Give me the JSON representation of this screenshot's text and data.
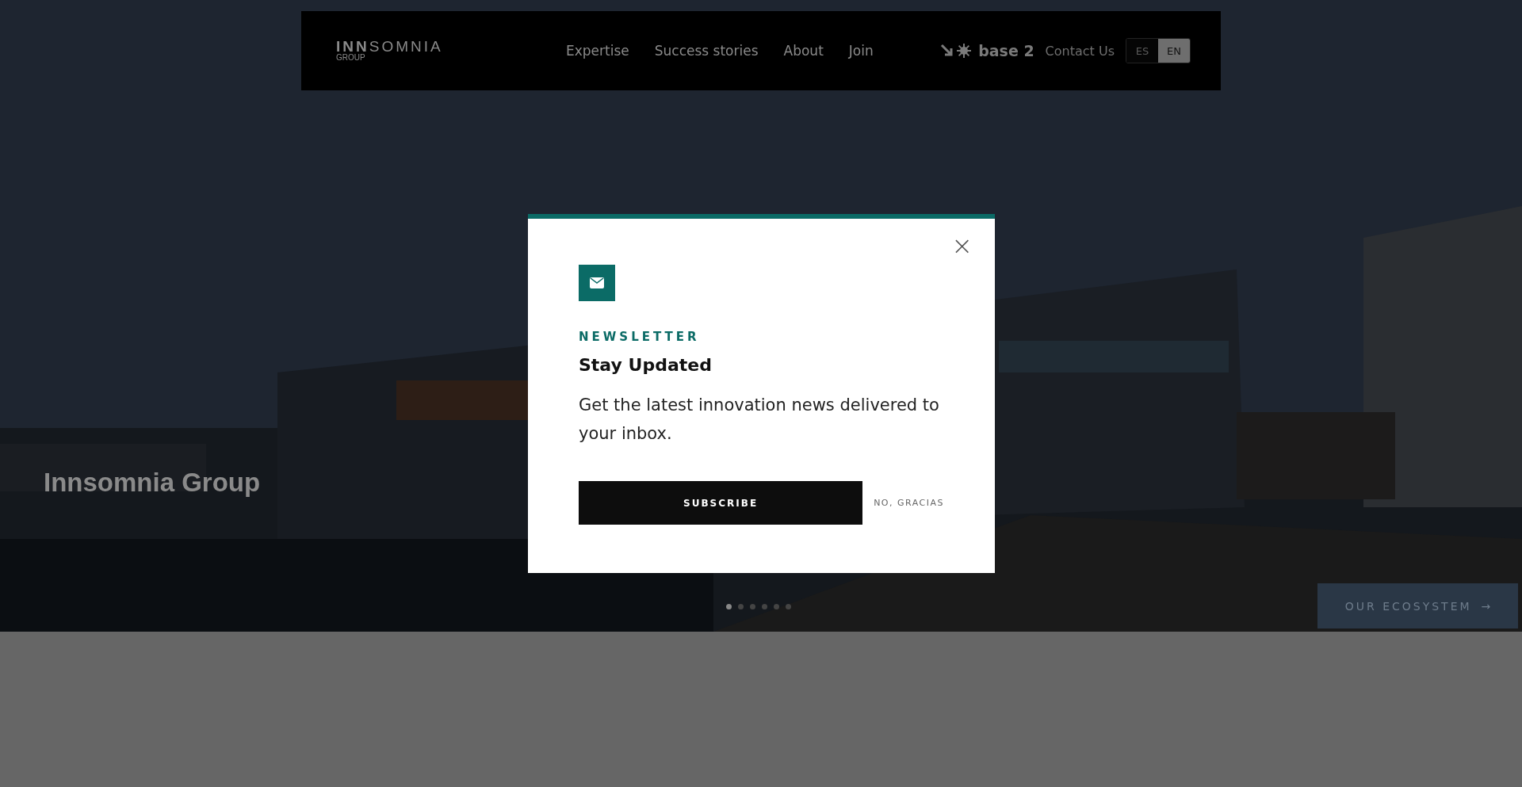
{
  "header": {
    "logo": {
      "strong": "INN",
      "light": "SOMNIA",
      "sub": "GROUP"
    },
    "nav": [
      {
        "label": "Expertise"
      },
      {
        "label": "Success stories"
      },
      {
        "label": "About"
      },
      {
        "label": "Join"
      }
    ],
    "partner": "base 2",
    "contact": "Contact Us",
    "languages": [
      {
        "label": "ES",
        "selected": false
      },
      {
        "label": "EN",
        "selected": true
      }
    ]
  },
  "hero": {
    "kind": "picture",
    "title": "Innsomnia Group",
    "dots": [
      {
        "selected": true
      },
      {
        "selected": false
      },
      {
        "selected": false
      },
      {
        "selected": false
      },
      {
        "selected": false
      },
      {
        "selected": false
      }
    ],
    "cta": "OUR ECOSYSTEM",
    "cta_arrow": "→"
  },
  "modal": {
    "close": "×",
    "eyebrow": "NEWSLETTER",
    "title": "Stay Updated",
    "text": "Get the latest innovation news delivered to your inbox.",
    "subscribe": "SUBSCRIBE",
    "decline": "NO, GRACIAS"
  }
}
